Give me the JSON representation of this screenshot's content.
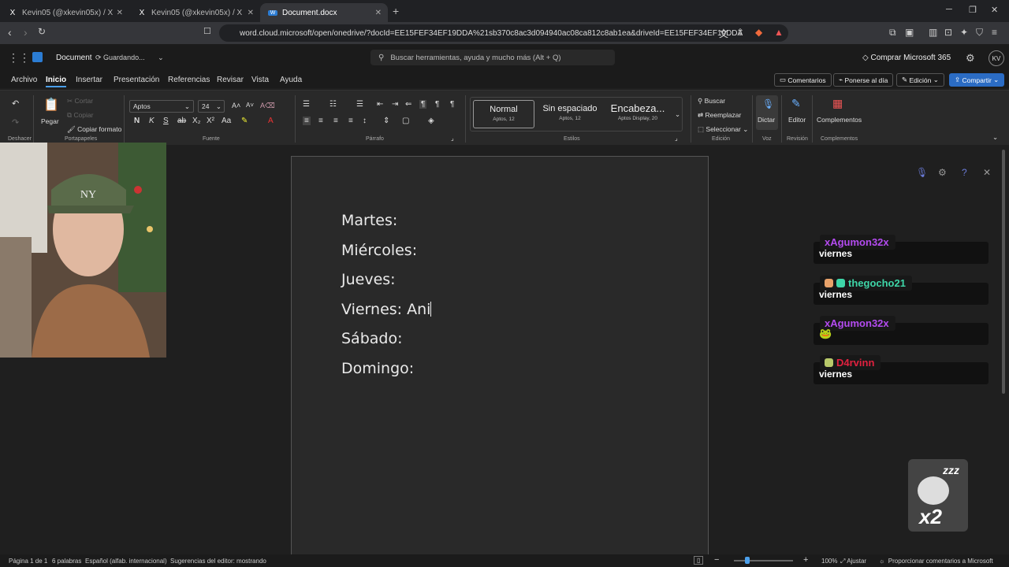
{
  "browser": {
    "tabs": [
      {
        "icon": "X",
        "title": "Kevin05 (@xkevin05x) / X"
      },
      {
        "icon": "X",
        "title": "Kevin05 (@xkevin05x) / X"
      },
      {
        "icon": "W",
        "title": "Document.docx"
      }
    ],
    "url": "word.cloud.microsoft/open/onedrive/?docId=EE15FEF34EF19DDA%21sb370c8ac3d094940ac08ca812c8ab1ea&driveId=EE15FEF34EF19DDA"
  },
  "app": {
    "doc_name": "Document",
    "status": "Guardando...",
    "search_placeholder": "Buscar herramientas, ayuda y mucho más (Alt + Q)",
    "buy_label": "Comprar Microsoft 365",
    "user_initials": "KV"
  },
  "menus": [
    "Archivo",
    "Inicio",
    "Insertar",
    "Presentación",
    "Referencias",
    "Revisar",
    "Vista",
    "Ayuda"
  ],
  "menu_buttons": {
    "comments": "Comentarios",
    "catchup": "Ponerse al día",
    "edit": "Edición",
    "share": "Compartir"
  },
  "ribbon": {
    "undo_group": "Deshacer",
    "paste": "Pegar",
    "cut": "Cortar",
    "copy": "Copiar",
    "format_painter": "Copiar formato",
    "clipboard_group": "Portapapeles",
    "font_name": "Aptos",
    "font_size": "24",
    "font_group": "Fuente",
    "paragraph_group": "Párrafo",
    "styles": [
      {
        "name": "Normal",
        "desc": "Aptos, 12"
      },
      {
        "name": "Sin espaciado",
        "desc": "Aptos, 12"
      },
      {
        "name": "Encabeza...",
        "desc": "Aptos Display, 20"
      }
    ],
    "styles_group": "Estilos",
    "find": "Buscar",
    "replace": "Reemplazar",
    "select": "Seleccionar",
    "editing_group": "Edición",
    "dictate": "Dictar",
    "voice_group": "Voz",
    "editor": "Editor",
    "review_group": "Revisión",
    "addins": "Complementos",
    "addins_group": "Complementos"
  },
  "document": {
    "lines": [
      "Martes:",
      "Miércoles:",
      "Jueves:",
      "Viernes: Ani",
      "Sábado:",
      "Domingo:"
    ]
  },
  "chat": [
    {
      "user": "xAgumon32x",
      "color": "#b44bf0",
      "text": "viernes"
    },
    {
      "user": "thegocho21",
      "color": "#3ed6a8",
      "text": "viernes"
    },
    {
      "user": "xAgumon32x",
      "color": "#b44bf0",
      "text": "🐸"
    },
    {
      "user": "D4rvinn",
      "color": "#e0213f",
      "text": "viernes"
    }
  ],
  "sticker": {
    "top": "zzz",
    "bottom": "x2"
  },
  "statusbar": {
    "page": "Página 1 de 1",
    "words": "6 palabras",
    "language": "Español (alfab. internacional)",
    "editor_suggestions": "Sugerencias del editor: mostrando",
    "zoom": "100%",
    "fit": "Ajustar",
    "feedback": "Proporcionar comentarios a Microsoft"
  }
}
